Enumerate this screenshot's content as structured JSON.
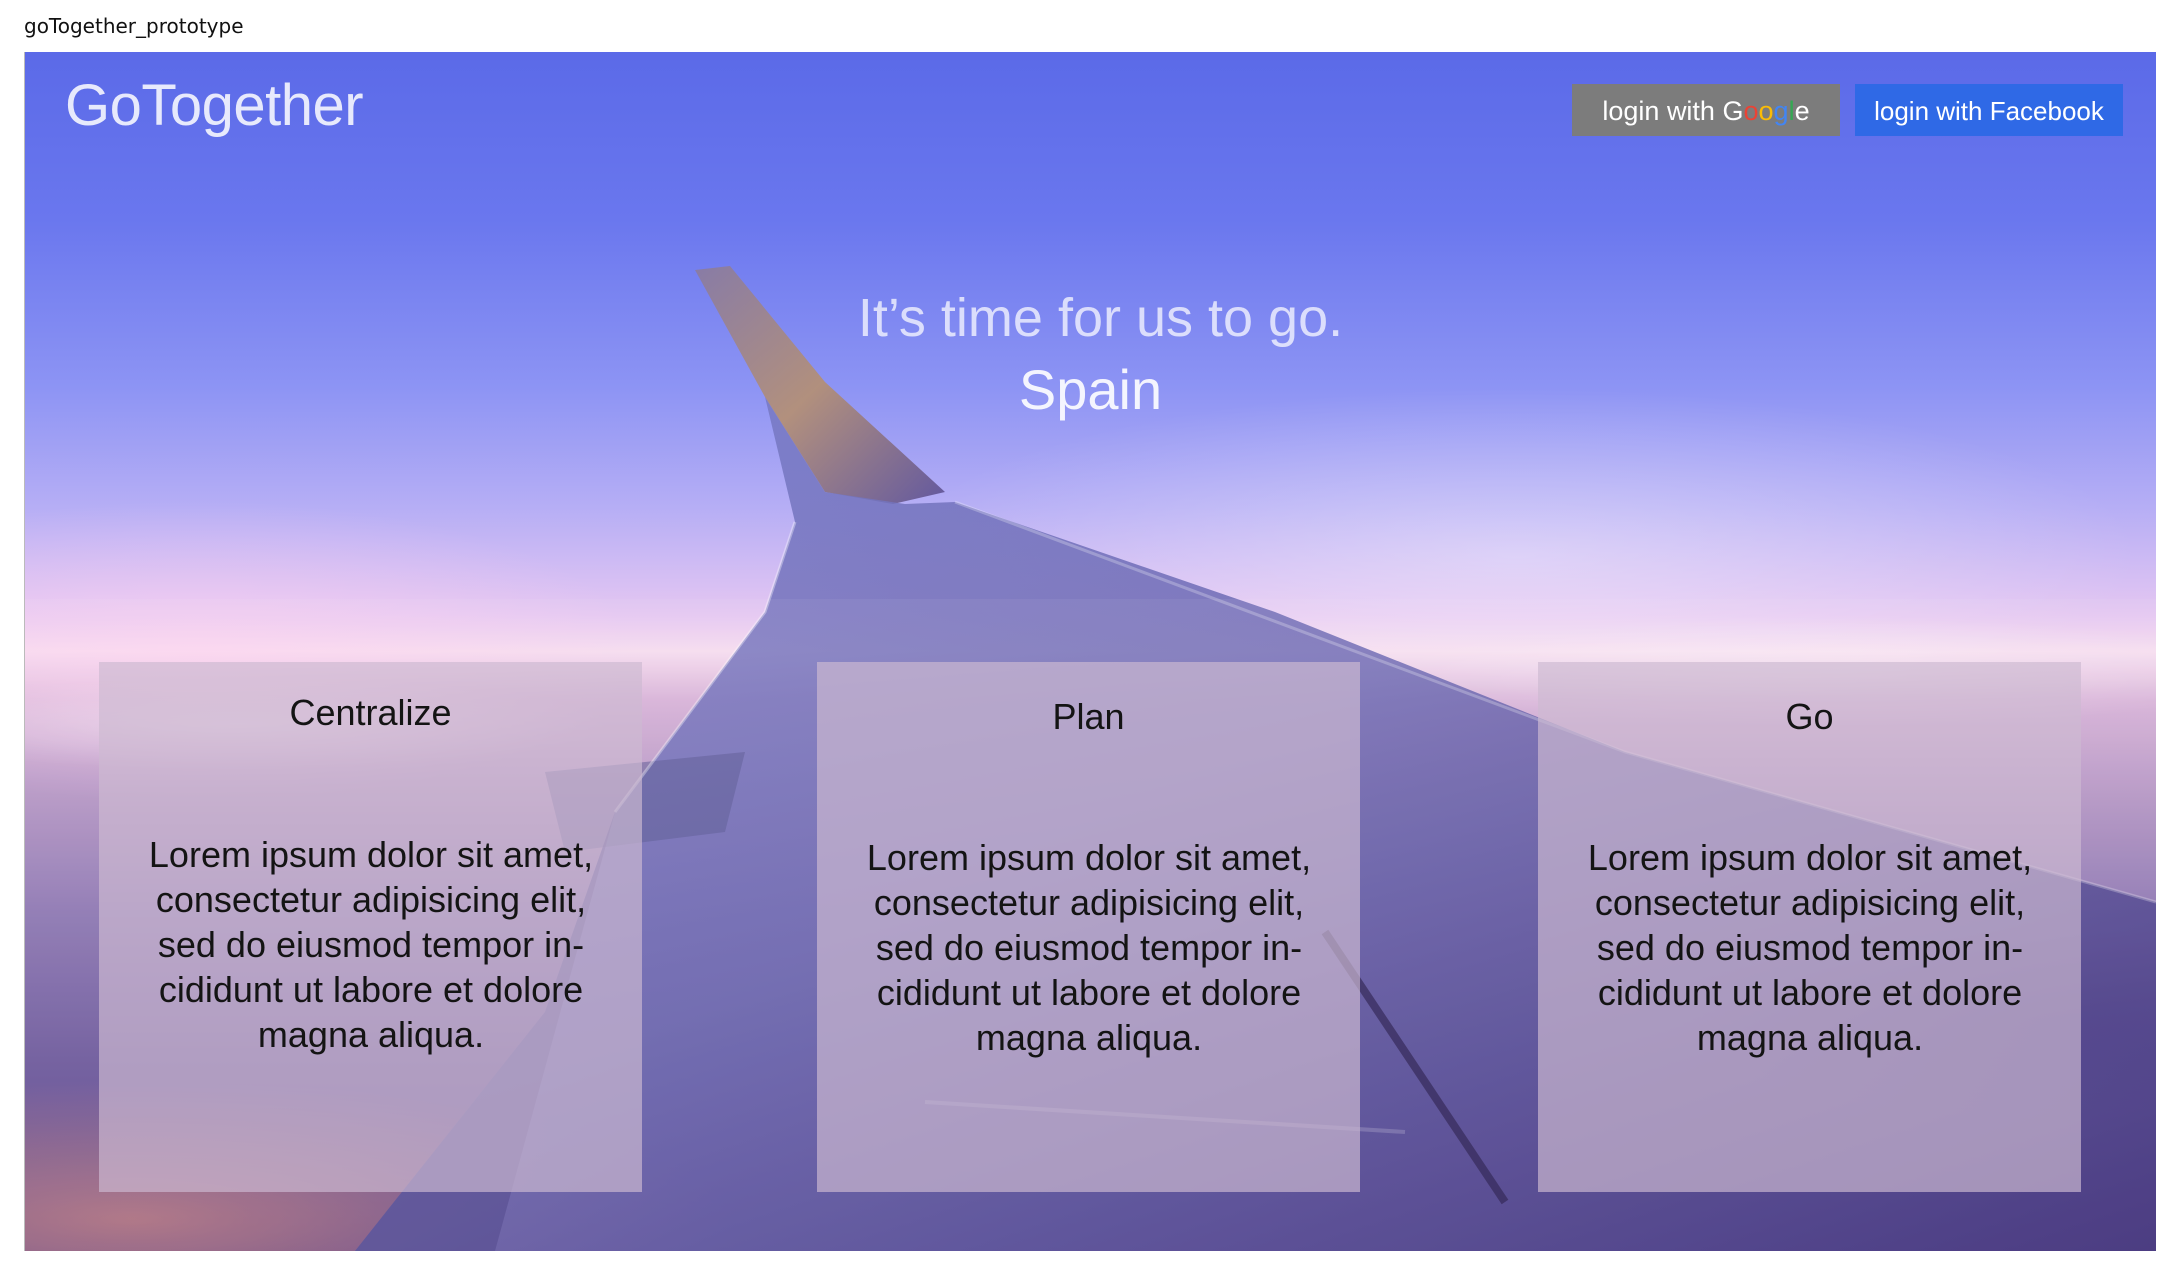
{
  "window": {
    "title": "goTogether_prototype"
  },
  "header": {
    "logo": "GoTogether",
    "google_login": {
      "prefix": "login with ",
      "brand": [
        "G",
        "o",
        "o",
        "g",
        "l",
        "e"
      ]
    },
    "facebook_login": "login with Facebook"
  },
  "hero": {
    "tagline": "It’s time for us to go.",
    "destination": "Spain"
  },
  "cards": [
    {
      "title": "Centralize",
      "body": "Lorem ipsum dolor sit amet, consectetur adipisicing elit, sed do eiusmod tempor in-cididunt ut labore et dolore magna aliqua."
    },
    {
      "title": "Plan",
      "body": "Lorem ipsum dolor sit amet, consectetur adipisicing elit, sed do eiusmod tempor in-cididunt ut labore et dolore magna aliqua."
    },
    {
      "title": "Go",
      "body": "Lorem ipsum dolor sit amet, consectetur adipisicing elit, sed do eiusmod tempor in-cididunt ut labore et dolore magna aliqua."
    }
  ],
  "colors": {
    "google_button": "#7c7c7c",
    "facebook_button": "#2f69e6",
    "google_brand": [
      "#4285f4",
      "#ea4335",
      "#fbbc05",
      "#4285f4",
      "#34a853",
      "#ea4335"
    ]
  }
}
